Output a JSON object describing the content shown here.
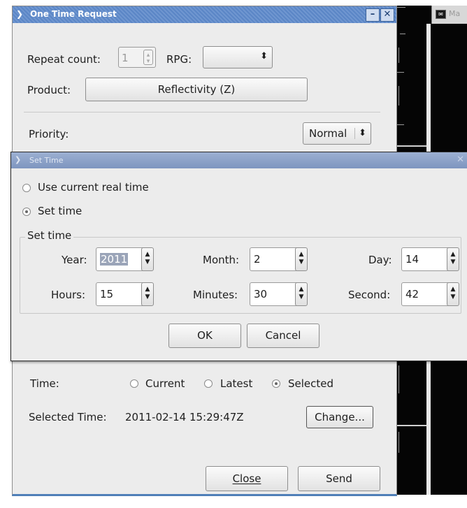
{
  "background_app": {
    "title": "Ma"
  },
  "one_time_request": {
    "title": "One Time Request",
    "repeat_count_label": "Repeat count:",
    "repeat_count_value": "1",
    "rpg_label": "RPG:",
    "rpg_value": "",
    "product_label": "Product:",
    "product_value": "Reflectivity (Z)",
    "priority_label": "Priority:",
    "priority_value": "Normal",
    "time_label": "Time:",
    "time_options": [
      "Current",
      "Latest",
      "Selected"
    ],
    "time_selected": "Selected",
    "selected_time_label": "Selected Time:",
    "selected_time_value": "2011-02-14 15:29:47Z",
    "change_button": "Change...",
    "close_button": "Close",
    "send_button": "Send"
  },
  "set_time": {
    "title": "Set Time",
    "use_current_label": "Use current real time",
    "set_time_label": "Set time",
    "group_title": "Set time",
    "year_label": "Year:",
    "year_value": "2011",
    "month_label": "Month:",
    "month_value": "2",
    "day_label": "Day:",
    "day_value": "14",
    "hours_label": "Hours:",
    "hours_value": "15",
    "minutes_label": "Minutes:",
    "minutes_value": "30",
    "second_label": "Second:",
    "second_value": "42",
    "ok_button": "OK",
    "cancel_button": "Cancel"
  }
}
